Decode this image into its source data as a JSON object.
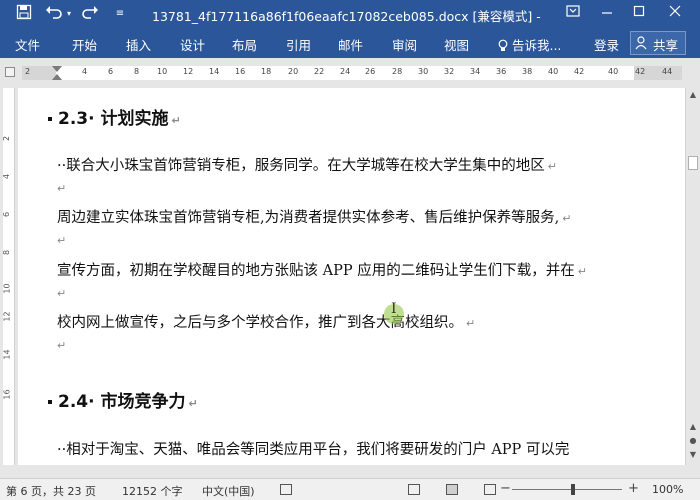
{
  "titlebar": {
    "save_icon": "save-icon",
    "undo_icon": "undo-icon",
    "redo_icon": "redo-icon",
    "customize_icon": "customize-icon",
    "title": "13781_4f177116a86f1f06eaafc17082ceb085.docx [兼容模式] -",
    "color": "#2b579a"
  },
  "ribbon": {
    "tabs": [
      "文件",
      "开始",
      "插入",
      "设计",
      "布局",
      "引用",
      "邮件",
      "审阅",
      "视图"
    ],
    "tell_me": "告诉我...",
    "login": "登录",
    "share": "共享"
  },
  "ruler": {
    "numbers": [
      "2",
      "2",
      "4",
      "6",
      "8",
      "10",
      "12",
      "14",
      "16",
      "18",
      "20",
      "22",
      "24",
      "26",
      "28",
      "30",
      "32",
      "34",
      "36",
      "38",
      "40",
      "42",
      "44"
    ]
  },
  "vruler": {
    "numbers": [
      "2",
      "4",
      "6",
      "8",
      "10",
      "12",
      "14",
      "16"
    ]
  },
  "document": {
    "heading1": "2.3· 计划实施",
    "para1_line1": "··联合大小珠宝首饰营销专柜，服务同学。在大学城等在校大学生集中的地区",
    "para1_line2": "周边建立实体珠宝首饰营销专柜,为消费者提供实体参考、售后维护保养等服务,",
    "para1_line3": "宣传方面，初期在学校醒目的地方张贴该 APP 应用的二维码让学生们下载，并在",
    "para1_line4": "校内网上做宣传，之后与多个学校合作，推广到各大高校组织。",
    "heading2": "2.4· 市场竞争力",
    "para2_line1": "··相对于淘宝、天猫、唯品会等同类应用平台，我们将要研发的门户 APP 可以完",
    "paragraph_mark": "↵"
  },
  "status": {
    "page": "第 6 页，共 23 页",
    "words": "12152 个字",
    "language": "中文(中国)",
    "zoom": "100%",
    "zoom_minus": "−",
    "zoom_plus": "+"
  }
}
